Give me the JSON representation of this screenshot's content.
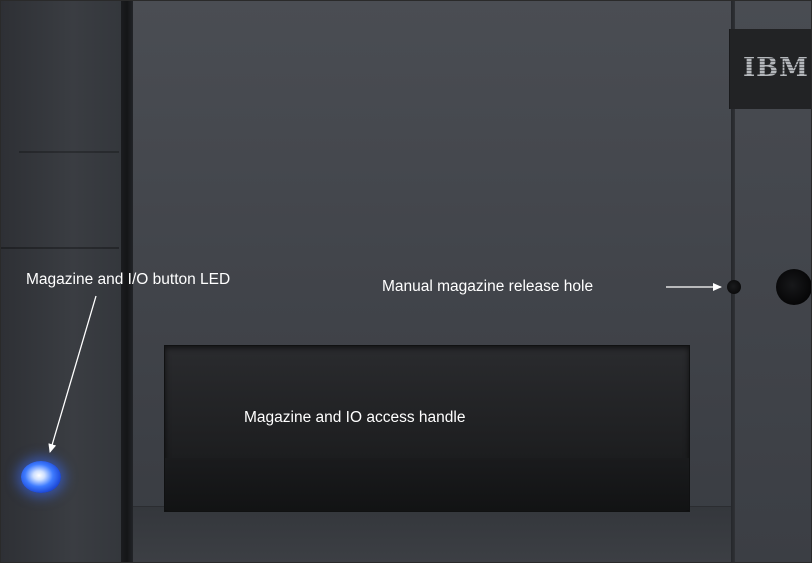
{
  "photo": {
    "subject": "tape library front panel",
    "logo_text": "IBM",
    "colors": {
      "panel": "#43464c",
      "handle": "#1f2022",
      "led": "#3e7bff",
      "annotation_text": "#ffffff"
    }
  },
  "annotations": {
    "led_label": "Magazine and I/O button LED",
    "handle_label": "Magazine and IO access handle",
    "release_hole_label": "Manual magazine release hole"
  }
}
